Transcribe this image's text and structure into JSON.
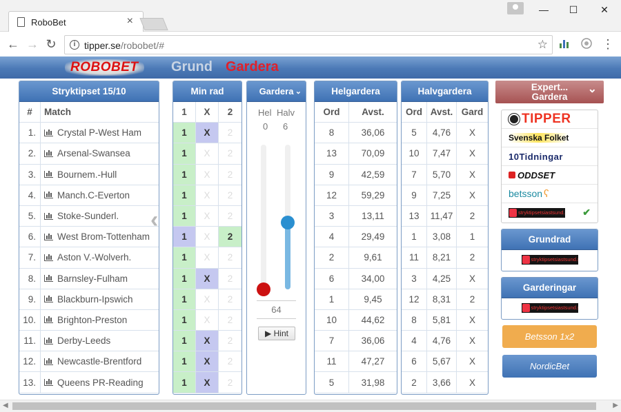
{
  "browser": {
    "tab_title": "RoboBet",
    "url_domain": "tipper.se",
    "url_path": "/robobet/#",
    "window_buttons": [
      "—",
      "☐",
      "✕"
    ]
  },
  "app": {
    "logo_text": "ROBOBET",
    "nav": [
      "Grund",
      "Gardera"
    ]
  },
  "matches_panel": {
    "title": "Stryktipset 15/10",
    "col_num": "#",
    "col_match": "Match",
    "rows": [
      {
        "n": "1.",
        "match": "Crystal P-West Ham"
      },
      {
        "n": "2.",
        "match": "Arsenal-Swansea"
      },
      {
        "n": "3.",
        "match": "Bournem.-Hull"
      },
      {
        "n": "4.",
        "match": "Manch.C-Everton"
      },
      {
        "n": "5.",
        "match": "Stoke-Sunderl."
      },
      {
        "n": "6.",
        "match": "West Brom-Tottenham"
      },
      {
        "n": "7.",
        "match": "Aston V.-Wolverh."
      },
      {
        "n": "8.",
        "match": "Barnsley-Fulham"
      },
      {
        "n": "9.",
        "match": "Blackburn-Ipswich"
      },
      {
        "n": "10.",
        "match": "Brighton-Preston"
      },
      {
        "n": "11.",
        "match": "Derby-Leeds"
      },
      {
        "n": "12.",
        "match": "Newcastle-Brentford"
      },
      {
        "n": "13.",
        "match": "Queens PR-Reading"
      }
    ]
  },
  "minrad_panel": {
    "title": "Min rad",
    "cols": [
      "1",
      "X",
      "2"
    ],
    "rows": [
      [
        "on",
        "on",
        "off"
      ],
      [
        "on",
        "off",
        "off"
      ],
      [
        "on",
        "off",
        "off"
      ],
      [
        "on",
        "off",
        "off"
      ],
      [
        "on",
        "off",
        "off"
      ],
      [
        "onx",
        "off",
        "on"
      ],
      [
        "on",
        "off",
        "off"
      ],
      [
        "on",
        "on",
        "off"
      ],
      [
        "on",
        "off",
        "off"
      ],
      [
        "on",
        "off",
        "off"
      ],
      [
        "on",
        "on",
        "off"
      ],
      [
        "on",
        "on",
        "off"
      ],
      [
        "on",
        "on",
        "off"
      ]
    ]
  },
  "gardera_panel": {
    "title": "Gardera",
    "hel_label": "Hel",
    "halv_label": "Halv",
    "hel_value": "0",
    "halv_value": "6",
    "hel_fraction": 0.0,
    "halv_fraction": 0.46,
    "rows_count": "64",
    "hint_label": "Hint"
  },
  "helgardera_panel": {
    "title": "Helgardera",
    "cols": [
      "Ord",
      "Avst."
    ],
    "rows": [
      [
        "8",
        "36,06"
      ],
      [
        "13",
        "70,09"
      ],
      [
        "9",
        "42,59"
      ],
      [
        "12",
        "59,29"
      ],
      [
        "3",
        "13,11"
      ],
      [
        "4",
        "29,49"
      ],
      [
        "2",
        "9,61"
      ],
      [
        "6",
        "34,00"
      ],
      [
        "1",
        "9,45"
      ],
      [
        "10",
        "44,62"
      ],
      [
        "7",
        "36,06"
      ],
      [
        "11",
        "47,27"
      ],
      [
        "5",
        "31,98"
      ]
    ]
  },
  "halvgardera_panel": {
    "title": "Halvgardera",
    "cols": [
      "Ord",
      "Avst.",
      "Gard"
    ],
    "rows": [
      [
        "5",
        "4,76",
        "X"
      ],
      [
        "10",
        "7,47",
        "X"
      ],
      [
        "7",
        "5,70",
        "X"
      ],
      [
        "9",
        "7,25",
        "X"
      ],
      [
        "13",
        "11,47",
        "2"
      ],
      [
        "1",
        "3,08",
        "1"
      ],
      [
        "11",
        "8,21",
        "2"
      ],
      [
        "3",
        "4,25",
        "X"
      ],
      [
        "12",
        "8,31",
        "2"
      ],
      [
        "8",
        "5,81",
        "X"
      ],
      [
        "4",
        "4,76",
        "X"
      ],
      [
        "6",
        "5,67",
        "X"
      ],
      [
        "2",
        "3,66",
        "X"
      ]
    ]
  },
  "sidebar": {
    "expert_line1": "Expert...",
    "expert_line2": "Gardera",
    "sources": [
      "TIPPER",
      "Svenska Folket",
      "10Tidningar",
      "ODDSET",
      "betsson",
      "stryktipsetsiastsund.se"
    ],
    "grundrad_title": "Grundrad",
    "garderingar_title": "Garderingar",
    "stryk_logo_text": "stryktipsetsiastsund.se",
    "betsson_btn": "Betsson 1x2",
    "nordicbet_btn": "NordicBet"
  },
  "colors": {
    "panel_header": "#3f72b4",
    "pick_one": "#c8efc8",
    "pick_x": "#c5c8f0",
    "expert": "#a65252",
    "betsson": "#f0ac4e",
    "nordicbet": "#4b79b6"
  }
}
